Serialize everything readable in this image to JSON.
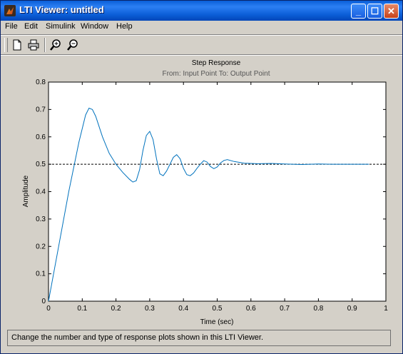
{
  "window": {
    "title": "LTI Viewer: untitled"
  },
  "menu": [
    "File",
    "Edit",
    "Simulink",
    "Window",
    "Help"
  ],
  "toolbar": {
    "icons": [
      "new-document-icon",
      "print-icon",
      "zoom-in-icon",
      "zoom-out-icon"
    ]
  },
  "status_text": "Change the number and type of response plots shown in this LTI Viewer.",
  "chart_data": {
    "type": "line",
    "title": "Step Response",
    "subtitle": "From: Input Point  To: Output Point",
    "xlabel": "Time (sec)",
    "ylabel": "Amplitude",
    "xlim": [
      0,
      1
    ],
    "ylim": [
      0,
      0.8
    ],
    "xticks": [
      "0",
      "0.1",
      "0.2",
      "0.3",
      "0.4",
      "0.5",
      "0.6",
      "0.7",
      "0.8",
      "0.9",
      "1"
    ],
    "yticks": [
      "0",
      "0.1",
      "0.2",
      "0.3",
      "0.4",
      "0.5",
      "0.6",
      "0.7",
      "0.8"
    ],
    "grid": false,
    "reference_line": 0.5,
    "line_color": "#0072bd",
    "series": [
      {
        "x": [
          0,
          0.03,
          0.06,
          0.09,
          0.11,
          0.12,
          0.13,
          0.14,
          0.16,
          0.18,
          0.2,
          0.22,
          0.24,
          0.25,
          0.26,
          0.27,
          0.28,
          0.29,
          0.3,
          0.31,
          0.32,
          0.33,
          0.34,
          0.35,
          0.36,
          0.37,
          0.38,
          0.39,
          0.4,
          0.41,
          0.42,
          0.43,
          0.44,
          0.45,
          0.46,
          0.47,
          0.48,
          0.49,
          0.5,
          0.51,
          0.52,
          0.53,
          0.55,
          0.58,
          0.62,
          0.66,
          0.7,
          0.75,
          0.8,
          0.84,
          0.88,
          0.92,
          0.95
        ],
        "y": [
          0,
          0.2,
          0.4,
          0.58,
          0.68,
          0.705,
          0.7,
          0.675,
          0.6,
          0.54,
          0.5,
          0.47,
          0.445,
          0.435,
          0.44,
          0.48,
          0.55,
          0.605,
          0.62,
          0.59,
          0.52,
          0.465,
          0.458,
          0.475,
          0.5,
          0.525,
          0.535,
          0.52,
          0.485,
          0.462,
          0.458,
          0.468,
          0.485,
          0.5,
          0.513,
          0.508,
          0.492,
          0.484,
          0.49,
          0.505,
          0.514,
          0.517,
          0.51,
          0.504,
          0.502,
          0.503,
          0.501,
          0.499,
          0.501,
          0.5,
          0.5,
          0.5,
          0.5
        ]
      }
    ]
  }
}
